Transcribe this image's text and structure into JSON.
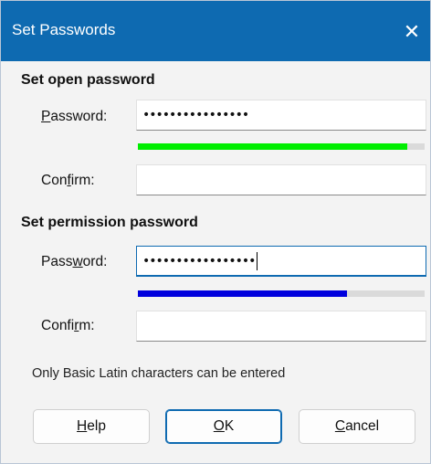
{
  "window": {
    "title": "Set Passwords",
    "close_glyph": "✕"
  },
  "open_section": {
    "heading": "Set open password",
    "password_label": {
      "pre": "",
      "key": "P",
      "post": "assword:"
    },
    "password_value": "••••••••••••••••",
    "strength_percent": 94,
    "strength_color": "#00ee00",
    "confirm_label": {
      "pre": "Con",
      "key": "f",
      "post": "irm:"
    },
    "confirm_value": ""
  },
  "permission_section": {
    "heading": "Set permission password",
    "password_label": {
      "pre": "Pass",
      "key": "w",
      "post": "ord:"
    },
    "password_value": "•••••••••••••••••",
    "strength_percent": 73,
    "strength_color": "#0000dd",
    "confirm_label": {
      "pre": "Confi",
      "key": "r",
      "post": "m:"
    },
    "confirm_value": ""
  },
  "note": "Only Basic Latin characters can be entered",
  "buttons": {
    "help": {
      "pre": "",
      "key": "H",
      "post": "elp"
    },
    "ok": {
      "pre": "",
      "key": "O",
      "post": "K"
    },
    "cancel": {
      "pre": "",
      "key": "C",
      "post": "ancel"
    }
  },
  "colors": {
    "accent": "#0e6ab1"
  }
}
